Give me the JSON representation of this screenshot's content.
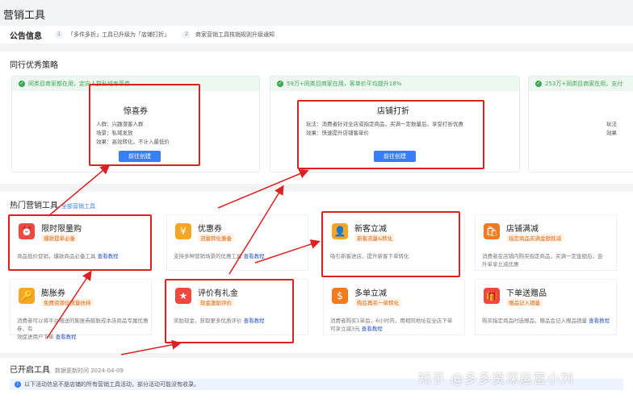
{
  "page": {
    "title": "营销工具"
  },
  "notice": {
    "label": "公告信息",
    "items": [
      {
        "num": "1",
        "text": "「多件多折」工具已升级为「店铺打折」"
      },
      {
        "num": "2",
        "text": "商家营销工具核销规则升级通知"
      }
    ]
  },
  "strategy": {
    "title": "同行优秀策略",
    "cards": [
      {
        "banner": "同类目商家都在用，定向人群私域专享券",
        "name": "惊喜券",
        "lines": [
          "人群：兴趣潜客人群",
          "场景：私域发放",
          "效果：高效转化，不计入最低价"
        ],
        "button": "前往创建"
      },
      {
        "banner": "59万+同类目商家在用，客单价平均提升18%",
        "name": "店铺打折",
        "lines": [
          "玩法：消费者针对全店或指定商品，买满一定数量后，享受打折优惠",
          "效果：快速提升店铺客单价"
        ],
        "button": "前往创建"
      },
      {
        "banner": "253万+同类目商家在用，支付",
        "lines": [
          "玩法",
          "效果"
        ]
      }
    ]
  },
  "hot": {
    "title": "热门营销工具",
    "all_link": "全部营销工具",
    "tools": [
      {
        "name": "限时限量购",
        "tag": "爆款提单必备",
        "desc": "商品低价促销，爆款商品必备工具",
        "link": "查看教程",
        "color": "#f0483e",
        "icon": "alarm-clock-icon",
        "glyph": "⏰"
      },
      {
        "name": "优惠券",
        "tag": "流量转化兼备",
        "desc": "支持多种营销场景的优惠工具",
        "link": "查看教程",
        "color": "#f5a623",
        "icon": "coupon-icon",
        "glyph": "¥"
      },
      {
        "name": "新客立减",
        "tag": "新客流量&转化",
        "desc": "吸引新客进店，提升新客下单转化",
        "link": "",
        "color": "#f5a623",
        "icon": "new-customer-icon",
        "glyph": "👤"
      },
      {
        "name": "店铺满减",
        "tag": "指定商品买满金额就减",
        "desc": "消费者在店铺内购买指定商品，买满一定金额后，会",
        "desc2": "升单享立减优惠",
        "link": "",
        "color": "#f37b1d",
        "icon": "shop-discount-icon",
        "glyph": "🛍"
      },
      {
        "name": "膨胀券",
        "tag": "免费资源位流量扶持",
        "desc": "消费者可以将平台赠送的膨胀券膨胀成本店商品专属优惠券，有",
        "desc2": "效促进用户下单",
        "link": "查看教程",
        "color": "#f5a623",
        "icon": "expand-coupon-icon",
        "glyph": "🔑"
      },
      {
        "name": "评价有礼金",
        "tag": "现金激励评价",
        "desc": "奖励现金，获取更多优质评价",
        "link": "查看教程",
        "color": "#f0483e",
        "icon": "review-reward-icon",
        "glyph": "★"
      },
      {
        "name": "多单立减",
        "tag": "购后再买一单转化",
        "desc": "消费者购买1单后，6小时内，用相同地址在全店下单",
        "desc2": "可享立减3元",
        "link": "查看教程",
        "color": "#f37b1d",
        "icon": "multi-order-icon",
        "glyph": "$"
      },
      {
        "name": "下单送赠品",
        "tag": "赠品记入销量",
        "desc": "购买指定商品时选赠品，赠品会记入赠品销量",
        "link": "查看教程",
        "color": "#f0483e",
        "icon": "gift-icon",
        "glyph": "🎁"
      }
    ]
  },
  "opened": {
    "title": "已开启工具",
    "updated": "数据更新时间 2024-04-09",
    "info": "以下活动信息不是店铺的所有营销工具活动，部分活动可能没有收录。"
  },
  "watermark": "知乎 @多多资深运营小刘"
}
